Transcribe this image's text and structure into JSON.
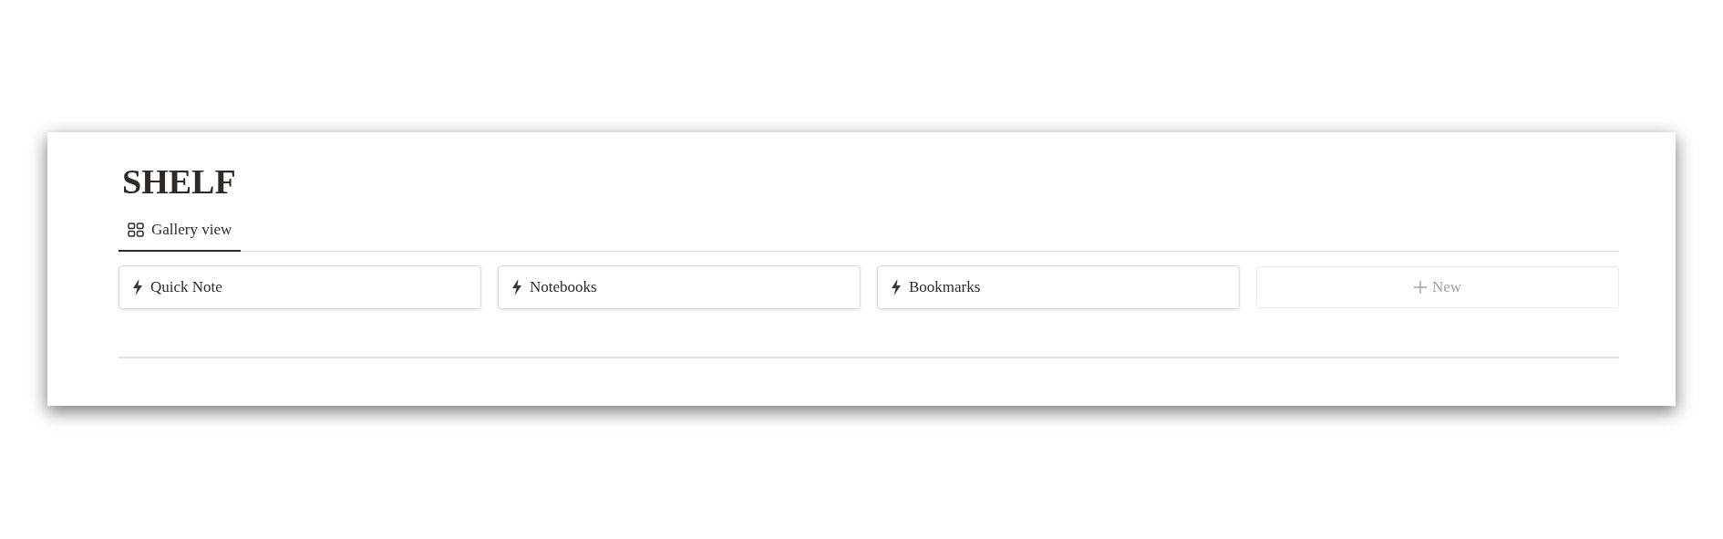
{
  "title": "SHELF",
  "tabs": [
    {
      "label": "Gallery view",
      "selected": true
    }
  ],
  "cards": [
    {
      "label": "Quick Note"
    },
    {
      "label": "Notebooks"
    },
    {
      "label": "Bookmarks"
    }
  ],
  "new_button": {
    "label": "New"
  }
}
